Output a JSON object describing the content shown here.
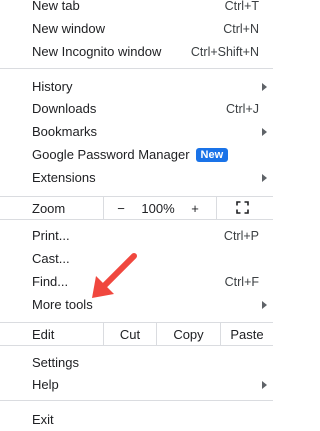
{
  "menu": {
    "new_tab": {
      "label": "New tab",
      "shortcut": "Ctrl+T"
    },
    "new_window": {
      "label": "New window",
      "shortcut": "Ctrl+N"
    },
    "new_incognito": {
      "label": "New Incognito window",
      "shortcut": "Ctrl+Shift+N"
    },
    "history": {
      "label": "History"
    },
    "downloads": {
      "label": "Downloads",
      "shortcut": "Ctrl+J"
    },
    "bookmarks": {
      "label": "Bookmarks"
    },
    "password_manager": {
      "label": "Google Password Manager",
      "badge": "New"
    },
    "extensions": {
      "label": "Extensions"
    },
    "zoom": {
      "label": "Zoom",
      "minus": "−",
      "value": "100%",
      "plus": "+"
    },
    "print": {
      "label": "Print...",
      "shortcut": "Ctrl+P"
    },
    "cast": {
      "label": "Cast..."
    },
    "find": {
      "label": "Find...",
      "shortcut": "Ctrl+F"
    },
    "more_tools": {
      "label": "More tools"
    },
    "edit": {
      "label": "Edit",
      "cut": "Cut",
      "copy": "Copy",
      "paste": "Paste"
    },
    "settings": {
      "label": "Settings"
    },
    "help": {
      "label": "Help"
    },
    "exit": {
      "label": "Exit"
    }
  },
  "colors": {
    "badge_bg": "#1a73e8",
    "arrow": "#f0473e",
    "separator": "#dadce0"
  }
}
